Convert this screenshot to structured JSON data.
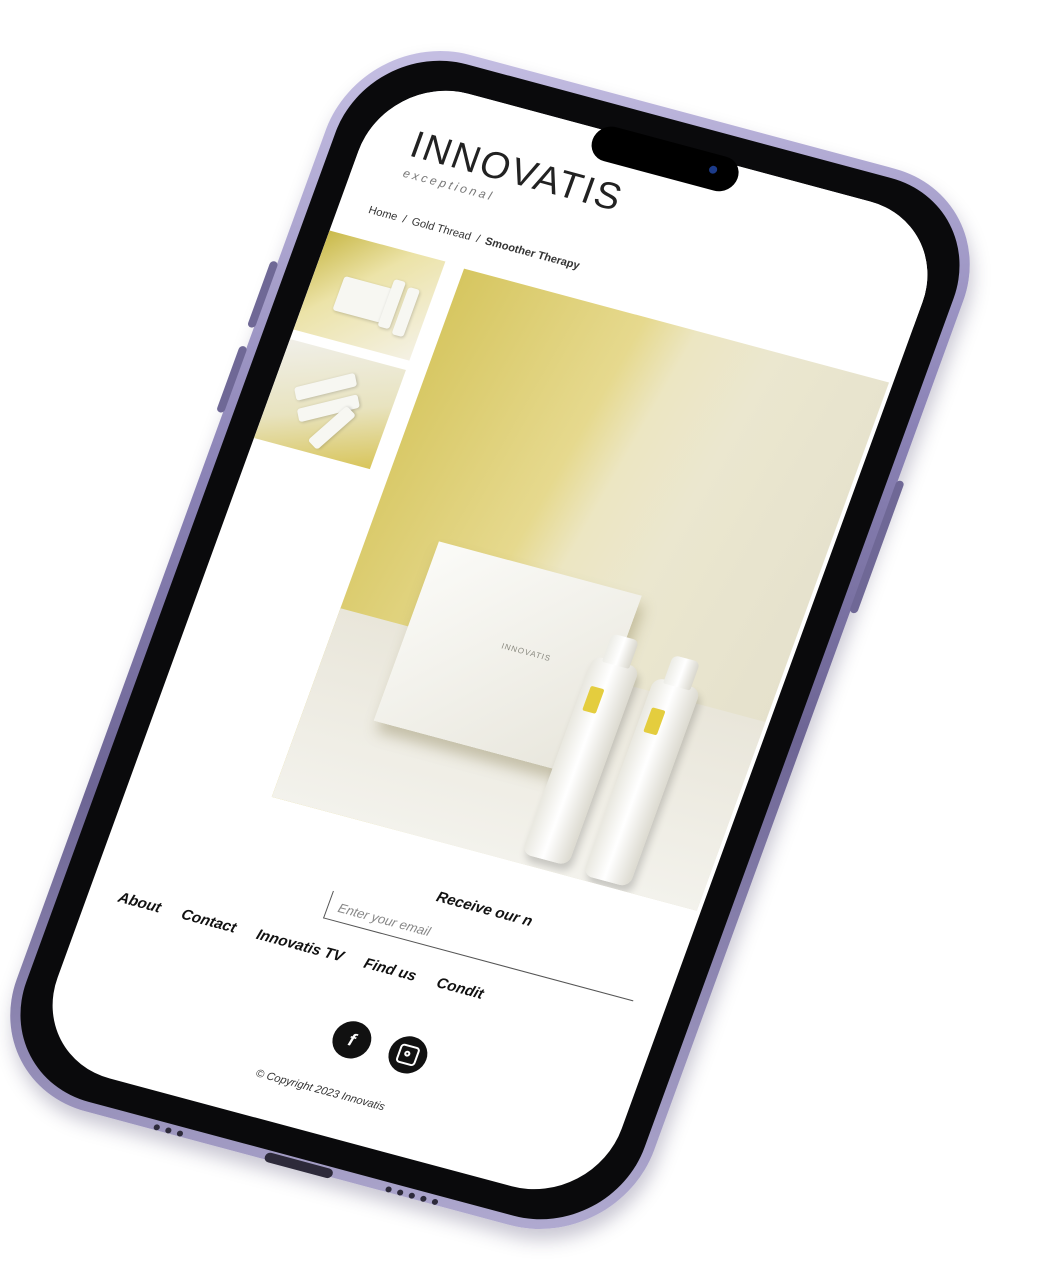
{
  "header": {
    "logo": "INNOVATIS",
    "tagline": "exceptional"
  },
  "breadcrumb": {
    "items": [
      "Home",
      "Gold Thread",
      "Smoother Therapy"
    ],
    "separator": "/"
  },
  "product": {
    "box_brand": "INNOVATIS",
    "accent_color": "#e4cd3e"
  },
  "newsletter": {
    "title": "Receive our n",
    "email_placeholder": "Enter your email"
  },
  "footer": {
    "nav": [
      "About",
      "Contact",
      "Innovatis TV",
      "Find us",
      "Condit"
    ],
    "social": [
      {
        "icon": "facebook-icon",
        "glyph": "f"
      },
      {
        "icon": "instagram-icon",
        "glyph": ""
      }
    ],
    "copyright": "© Copyright 2023 Innovatis"
  },
  "device": {
    "frame_color": "#8b83b6"
  }
}
